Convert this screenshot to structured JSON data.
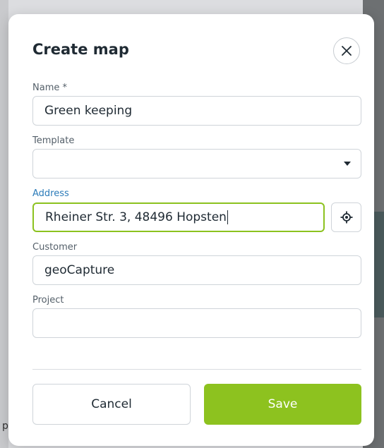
{
  "dialog": {
    "title": "Create map"
  },
  "form": {
    "name": {
      "label": "Name *",
      "value": "Green keeping"
    },
    "template": {
      "label": "Template",
      "value": ""
    },
    "address": {
      "label": "Address",
      "value": "Rheiner Str. 3, 48496 Hopsten"
    },
    "customer": {
      "label": "Customer",
      "value": "geoCapture"
    },
    "project": {
      "label": "Project",
      "value": ""
    }
  },
  "actions": {
    "cancel_label": "Cancel",
    "save_label": "Save"
  },
  "background": {
    "partial_text": "p"
  },
  "colors": {
    "accent_green": "#8dc21f",
    "focus_label_blue": "#2b7bb9"
  },
  "icons": {
    "close": "close-icon",
    "dropdown": "chevron-down-icon",
    "locate": "crosshair-icon"
  }
}
